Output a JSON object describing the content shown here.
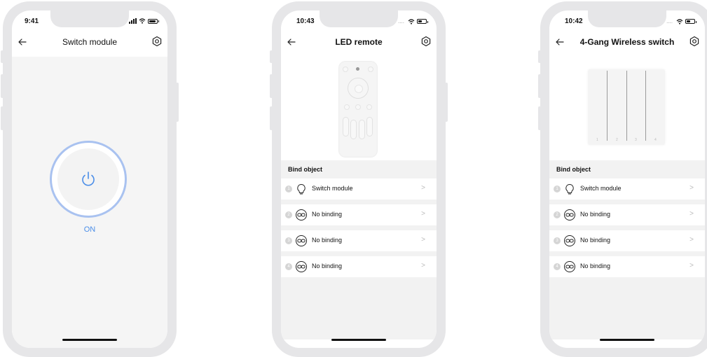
{
  "phones": [
    {
      "time": "9:41",
      "title": "Switch module",
      "power_state_label": "ON"
    },
    {
      "time": "10:43",
      "title": "LED remote",
      "section_title": "Bind object",
      "rows": [
        {
          "num": "1",
          "icon": "bulb-icon",
          "label": "Switch module"
        },
        {
          "num": "2",
          "icon": "link-icon",
          "label": "No binding"
        },
        {
          "num": "3",
          "icon": "link-icon",
          "label": "No binding"
        },
        {
          "num": "4",
          "icon": "link-icon",
          "label": "No binding"
        }
      ]
    },
    {
      "time": "10:42",
      "title": "4-Gang Wireless switch",
      "section_title": "Bind object",
      "switch_numbers": [
        "1",
        "2",
        "3",
        "4"
      ],
      "rows": [
        {
          "num": "1",
          "icon": "bulb-icon",
          "label": "Switch module"
        },
        {
          "num": "2",
          "icon": "link-icon",
          "label": "No binding"
        },
        {
          "num": "3",
          "icon": "link-icon",
          "label": "No binding"
        },
        {
          "num": "4",
          "icon": "link-icon",
          "label": "No binding"
        }
      ]
    }
  ],
  "colors": {
    "accent": "#4b8ee8",
    "ring": "#a9c2f0",
    "frame": "#e6e6e8",
    "list_bg": "#f2f2f2"
  },
  "chevron": ">"
}
